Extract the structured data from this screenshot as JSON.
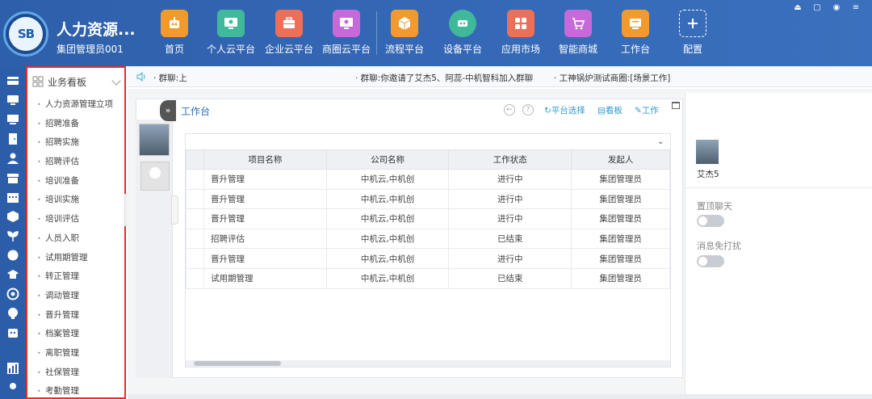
{
  "header": {
    "company": "人力资源...",
    "user": "集团管理员001",
    "logo_text": "SB",
    "nav": [
      {
        "label": "首页",
        "icon": "robot-icon",
        "color": "#f29a2e"
      },
      {
        "label": "个人云平台",
        "icon": "monitor-icon",
        "color": "#3fb99a"
      },
      {
        "label": "企业云平台",
        "icon": "briefcase-icon",
        "color": "#ec6f5a"
      },
      {
        "label": "商圈云平台",
        "icon": "screen-icon",
        "color": "#c56ad8"
      },
      {
        "label": "流程平台",
        "icon": "box-icon",
        "color": "#f29a2e"
      },
      {
        "label": "设备平台",
        "icon": "device-icon",
        "color": "#3fb99a"
      },
      {
        "label": "应用市场",
        "icon": "apps-icon",
        "color": "#ec6f5a"
      },
      {
        "label": "智能商城",
        "icon": "cart-icon",
        "color": "#c56ad8"
      },
      {
        "label": "工作台",
        "icon": "workbench-icon",
        "color": "#f29a2e"
      },
      {
        "label": "配置",
        "icon": "plus-icon",
        "color": "#3468b6"
      }
    ]
  },
  "sidebar": {
    "title": "业务看板",
    "items": [
      "人力资源管理立项",
      "招聘准备",
      "招聘实施",
      "招聘评估",
      "培训准备",
      "培训实施",
      "培训评估",
      "人员入职",
      "试用期管理",
      "转正管理",
      "调动管理",
      "晋升管理",
      "档案管理",
      "离职管理",
      "社保管理",
      "考勤管理"
    ]
  },
  "notice": {
    "items": [
      "· 群聊:上",
      "· 群聊:你邀请了艾杰5、阿蕊-中机智科加入群聊",
      "· 工神锅炉测试商圈:[场景工作]"
    ]
  },
  "workbench": {
    "title": "工作台",
    "tools": {
      "platform_select": "平台选择",
      "kanban": "看板",
      "work": "工作"
    },
    "table": {
      "columns": [
        "项目名称",
        "公司名称",
        "工作状态",
        "发起人"
      ],
      "rows": [
        [
          "晋升管理",
          "中机云,中机创",
          "进行中",
          "集团管理员"
        ],
        [
          "晋升管理",
          "中机云,中机创",
          "进行中",
          "集团管理员"
        ],
        [
          "晋升管理",
          "中机云,中机创",
          "进行中",
          "集团管理员"
        ],
        [
          "招聘评估",
          "中机云,中机创",
          "已结束",
          "集团管理员"
        ],
        [
          "晋升管理",
          "中机云,中机创",
          "进行中",
          "集团管理员"
        ],
        [
          "试用期管理",
          "中机云,中机创",
          "已结束",
          "集团管理员"
        ]
      ]
    }
  },
  "right_panel": {
    "name": "艾杰5",
    "pin_chat": "置顶聊天",
    "mute": "消息免打扰",
    "pin_enabled": false,
    "mute_enabled": false
  }
}
